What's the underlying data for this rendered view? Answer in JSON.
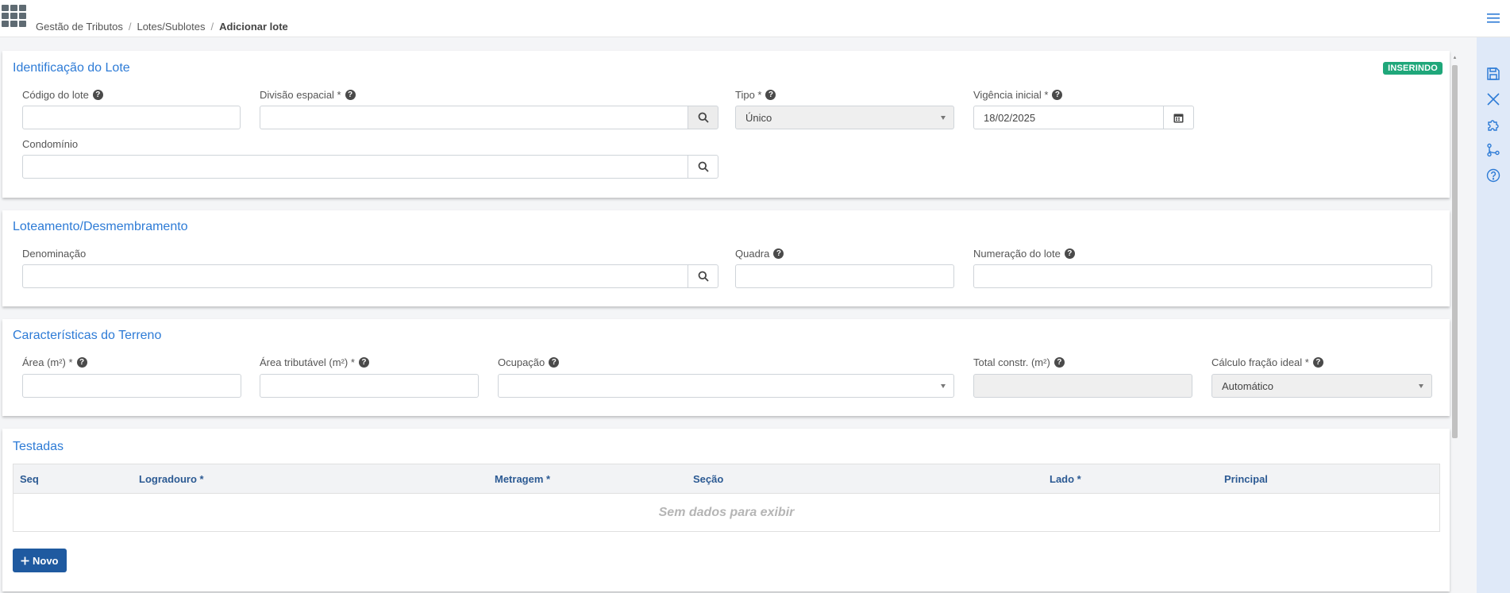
{
  "breadcrumb": {
    "item1": "Gestão de Tributos",
    "item2": "Lotes/Sublotes",
    "current": "Adicionar lote",
    "separator": "/"
  },
  "toolbar_icons": [
    "menu-icon",
    "save-icon",
    "close-icon",
    "puzzle-icon",
    "flow-icon",
    "help-icon"
  ],
  "identificacao": {
    "title": "Identificação do Lote",
    "status_badge": "INSERINDO",
    "codigo_label": "Código do lote",
    "codigo_value": "",
    "divisao_label": "Divisão espacial *",
    "divisao_value": "",
    "tipo_label": "Tipo *",
    "tipo_value": "Único",
    "vigencia_label": "Vigência inicial *",
    "vigencia_value": "18/02/2025",
    "condominio_label": "Condomínio",
    "condominio_value": ""
  },
  "loteamento": {
    "title": "Loteamento/Desmembramento",
    "denominacao_label": "Denominação",
    "quadra_label": "Quadra",
    "numeracao_label": "Numeração do lote"
  },
  "terreno": {
    "title": "Características do Terreno",
    "area_label": "Área (m²) *",
    "area_tributavel_label": "Área tributável (m²) *",
    "ocupacao_label": "Ocupação",
    "total_constr_label": "Total constr. (m²)",
    "calculo_label": "Cálculo fração ideal *",
    "calculo_value": "Automático"
  },
  "testadas": {
    "title": "Testadas",
    "columns": [
      "Seq",
      "Logradouro *",
      "Metragem *",
      "Seção",
      "Lado *",
      "Principal"
    ],
    "empty_text": "Sem dados para exibir",
    "new_button": "Novo"
  },
  "colors": {
    "accent": "#2d7bd6",
    "badge": "#1fa77a",
    "button": "#1f5aa0",
    "header_text": "#2c5a93"
  }
}
